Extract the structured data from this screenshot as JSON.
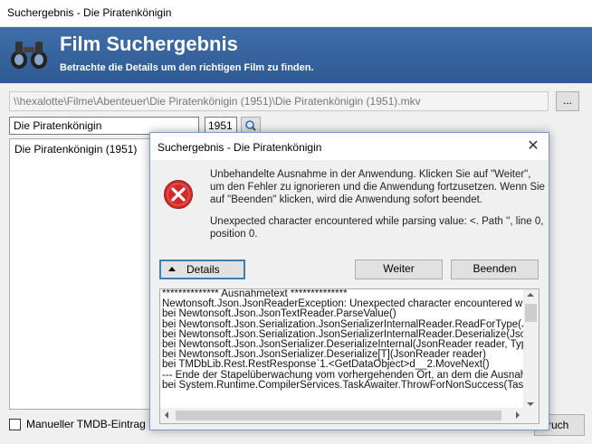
{
  "window": {
    "title": "Suchergebnis - Die Piratenkönigin"
  },
  "header": {
    "title": "Film Suchergebnis",
    "subtitle": "Betrachte die Details um den richtigen Film zu finden.",
    "icon": "binoculars-icon"
  },
  "file_path": "\\\\hexalotte\\Filme\\Abenteuer\\Die Piratenkönigin (1951)\\Die Piratenkönigin (1951).mkv",
  "browse_label": "...",
  "search": {
    "query": "Die Piratenkönigin",
    "year": "1951",
    "icon": "magnifier-icon"
  },
  "results": [
    "Die Piratenkönigin (1951)"
  ],
  "manual_checkbox": {
    "label": "Manueller TMDB-Eintrag",
    "checked": false
  },
  "bottom_button_label": "ruch",
  "dialog": {
    "title": "Suchergebnis - Die Piratenkönigin",
    "close_glyph": "✕",
    "icon": "error-icon",
    "message_lines": [
      "Unbehandelte Ausnahme in der Anwendung. Klicken Sie auf \"Weiter\",",
      "um den Fehler zu ignorieren und die Anwendung fortzusetzen. Wenn Sie",
      "auf \"Beenden\" klicken, wird die Anwendung sofort beendet."
    ],
    "error_lines": [
      "Unexpected character encountered while parsing value: <. Path '', line 0,",
      "position 0."
    ],
    "buttons": {
      "details": "Details",
      "continue": "Weiter",
      "quit": "Beenden"
    },
    "trace_lines": [
      "************** Ausnahmetext **************",
      "Newtonsoft.Json.JsonReaderException: Unexpected character encountered while pa",
      "   bei Newtonsoft.Json.JsonTextReader.ParseValue()",
      "   bei Newtonsoft.Json.Serialization.JsonSerializerInternalReader.ReadForType(JsonR",
      "   bei Newtonsoft.Json.Serialization.JsonSerializerInternalReader.Deserialize(JsonRea",
      "   bei Newtonsoft.Json.JsonSerializer.DeserializeInternal(JsonReader reader, Type obj",
      "   bei Newtonsoft.Json.JsonSerializer.Deserialize[T](JsonReader reader)",
      "   bei TMDbLib.Rest.RestResponse`1.<GetDataObject>d__2.MoveNext()",
      "--- Ende der Stapelüberwachung vom vorhergehenden Ort, an dem die Ausnahme au",
      "   bei System.Runtime.CompilerServices.TaskAwaiter.ThrowForNonSuccess(Task tas"
    ]
  }
}
